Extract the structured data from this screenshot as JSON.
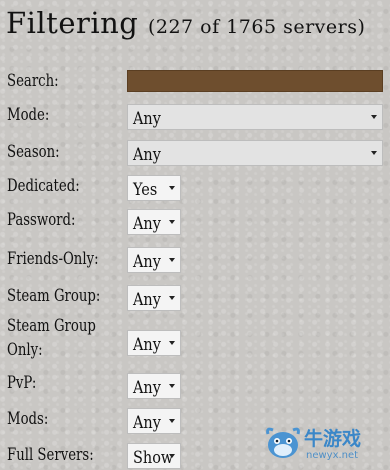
{
  "header": {
    "title": "Filtering",
    "count": "(227 of 1765 servers)"
  },
  "filters": {
    "search": {
      "label": "Search:",
      "value": ""
    },
    "mode": {
      "label": "Mode:",
      "value": "Any"
    },
    "season": {
      "label": "Season:",
      "value": "Any"
    },
    "dedicated": {
      "label": "Dedicated:",
      "value": "Yes"
    },
    "password": {
      "label": "Password:",
      "value": "Any"
    },
    "friends_only": {
      "label": "Friends-Only:",
      "value": "Any"
    },
    "steam_group": {
      "label": "Steam Group:",
      "value": "Any"
    },
    "steam_group_only": {
      "label_line1": "Steam Group",
      "label_line2": "Only:",
      "value": "Any"
    },
    "pvp": {
      "label": "PvP:",
      "value": "Any"
    },
    "mods": {
      "label": "Mods:",
      "value": "Any"
    },
    "full_servers": {
      "label": "Full Servers:",
      "value": "Show"
    }
  },
  "watermark": {
    "text": "牛游戏",
    "sub": "newyx.net"
  },
  "colors": {
    "search_fill": "#6e4e2e",
    "background": "#c9c7c4",
    "watermark": "#3b87c8"
  }
}
